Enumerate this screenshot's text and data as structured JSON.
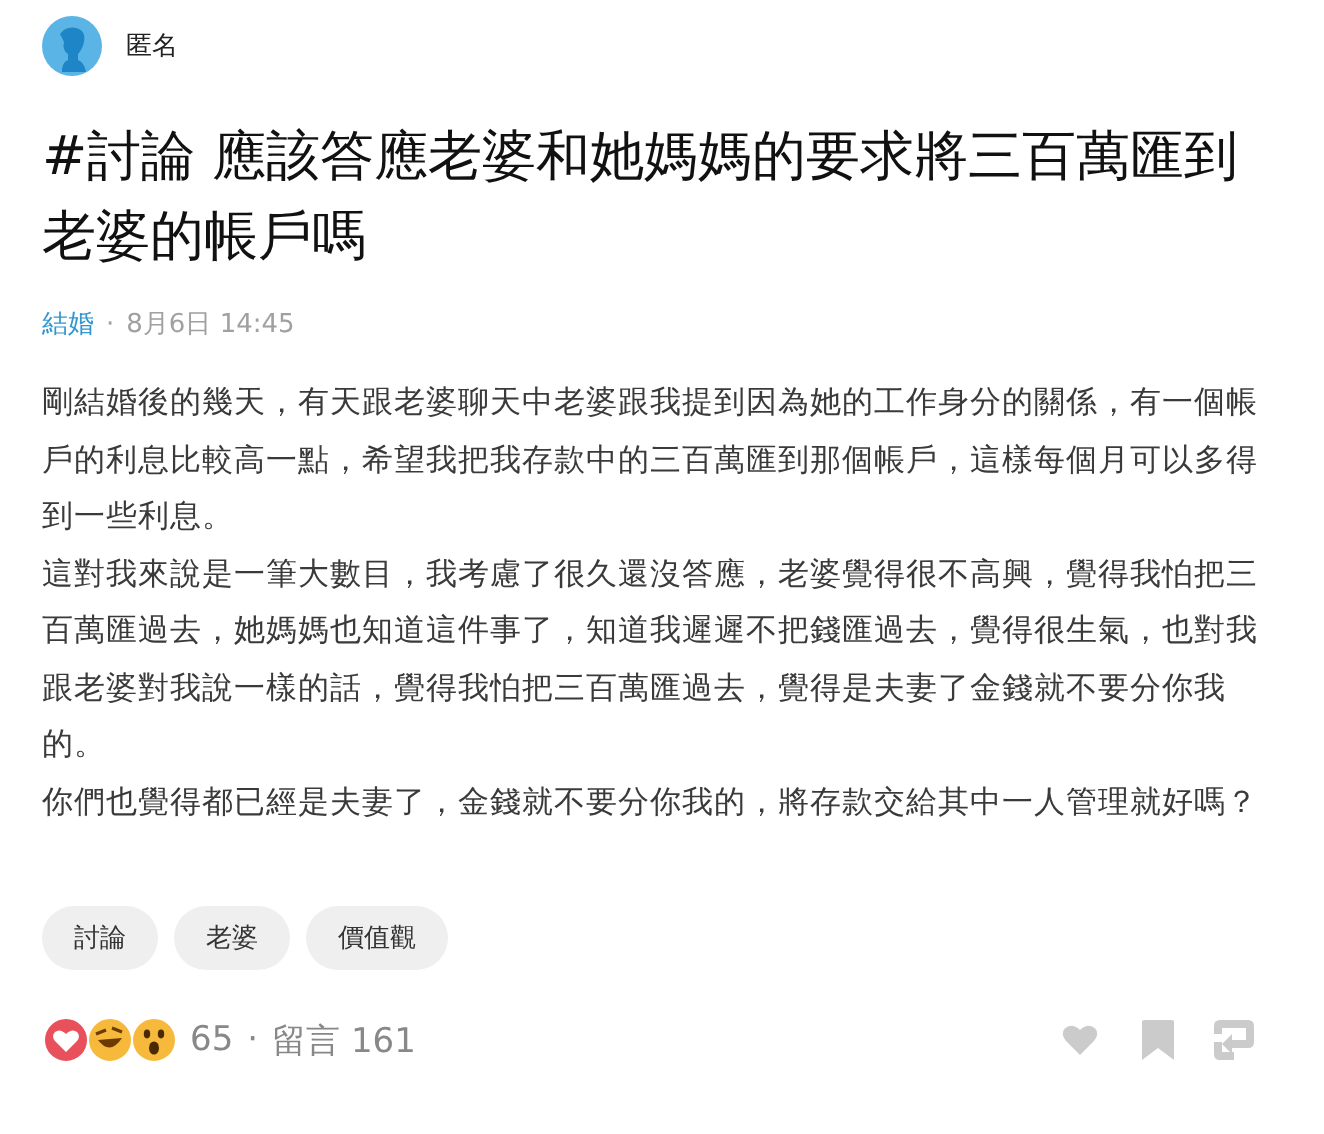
{
  "author": {
    "name": "匿名"
  },
  "title": "#討論 應該答應老婆和她媽媽的要求將三百萬匯到老婆的帳戶嗎",
  "meta": {
    "board": "結婚",
    "separator": "·",
    "date": "8月6日 14:45"
  },
  "paragraphs": [
    "剛結婚後的幾天，有天跟老婆聊天中老婆跟我提到因為她的工作身分的關係，有一個帳戶的利息比較高一點，希望我把我存款中的三百萬匯到那個帳戶，這樣每個月可以多得到一些利息。",
    "這對我來說是一筆大數目，我考慮了很久還沒答應，老婆覺得很不高興，覺得我怕把三百萬匯過去，她媽媽也知道這件事了，知道我遲遲不把錢匯過去，覺得很生氣，也對我跟老婆對我說一樣的話，覺得我怕把三百萬匯過去，覺得是夫妻了金錢就不要分你我的。",
    "你們也覺得都已經是夫妻了，金錢就不要分你我的，將存款交給其中一人管理就好嗎？"
  ],
  "tags": [
    "討論",
    "老婆",
    "價值觀"
  ],
  "footer": {
    "reactions": [
      {
        "kind": "heart"
      },
      {
        "kind": "laugh"
      },
      {
        "kind": "wow"
      }
    ],
    "reaction_count": "65",
    "separator": "·",
    "comments": "留言 161"
  }
}
